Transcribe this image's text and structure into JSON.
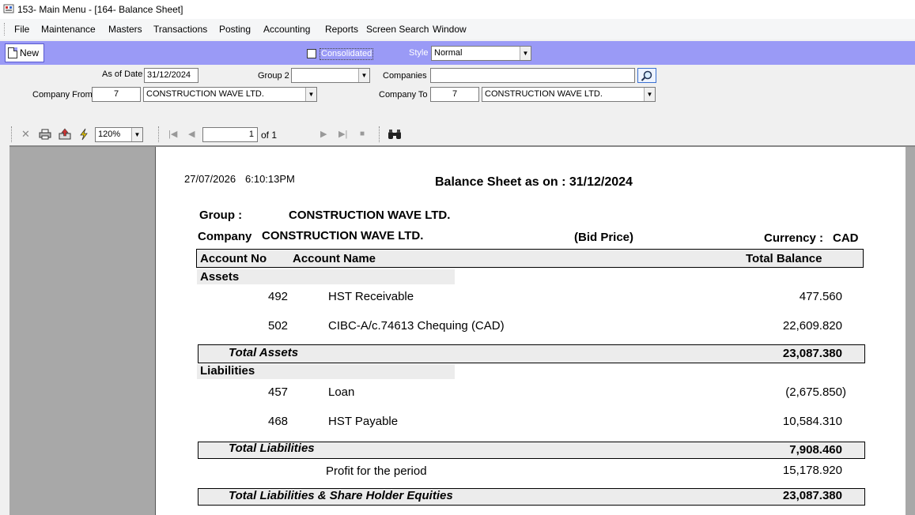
{
  "window": {
    "title": "153- Main Menu - [164- Balance Sheet]"
  },
  "menu": {
    "items": [
      "File",
      "Maintenance",
      "Masters",
      "Transactions",
      "Posting",
      "Accounting",
      "Reports",
      "Screen Search",
      "Window"
    ]
  },
  "toolbar": {
    "new_label": "New",
    "consolidated_label": "Consolidated",
    "consolidated_checked": false,
    "style_label": "Style",
    "style_value": "Normal"
  },
  "filters": {
    "as_of_date_label": "As of Date",
    "as_of_date_value": "31/12/2024",
    "group2_label": "Group 2",
    "group2_value": "",
    "companies_label": "Companies",
    "companies_value": "",
    "company_from_label": "Company From",
    "company_from_code": "7",
    "company_from_name": "CONSTRUCTION WAVE LTD.",
    "company_to_label": "Company To",
    "company_to_code": "7",
    "company_to_name": "CONSTRUCTION WAVE LTD."
  },
  "viewer": {
    "zoom": "120%",
    "page_current": "1",
    "page_of": "of 1"
  },
  "report": {
    "print_date": "27/07/2026",
    "print_time": "6:10:13PM",
    "title": "Balance Sheet as on : 31/12/2024",
    "group_label": "Group :",
    "group_value": "CONSTRUCTION WAVE LTD.",
    "company_label": "Company",
    "company_value": "CONSTRUCTION WAVE LTD.",
    "price_basis": "(Bid Price)",
    "currency_label": "Currency :",
    "currency_value": "CAD",
    "columns": {
      "account_no": "Account No",
      "account_name": "Account Name",
      "total_balance": "Total Balance"
    },
    "assets": {
      "heading": "Assets",
      "rows": [
        {
          "no": "492",
          "name": "HST Receivable",
          "balance": "477.560"
        },
        {
          "no": "502",
          "name": "CIBC-A/c.74613 Chequing (CAD)",
          "balance": "22,609.820"
        }
      ],
      "total_label": "Total Assets",
      "total_value": "23,087.380"
    },
    "liabilities": {
      "heading": "Liabilities",
      "rows": [
        {
          "no": "457",
          "name": "Loan",
          "balance": "(2,675.850)"
        },
        {
          "no": "468",
          "name": "HST Payable",
          "balance": "10,584.310"
        }
      ],
      "total_label": "Total Liabilities",
      "total_value": "7,908.460"
    },
    "profit_label": "Profit for the period",
    "profit_value": "15,178.920",
    "grand_total_label": "Total Liabilities & Share Holder Equities",
    "grand_total_value": "23,087.380"
  }
}
